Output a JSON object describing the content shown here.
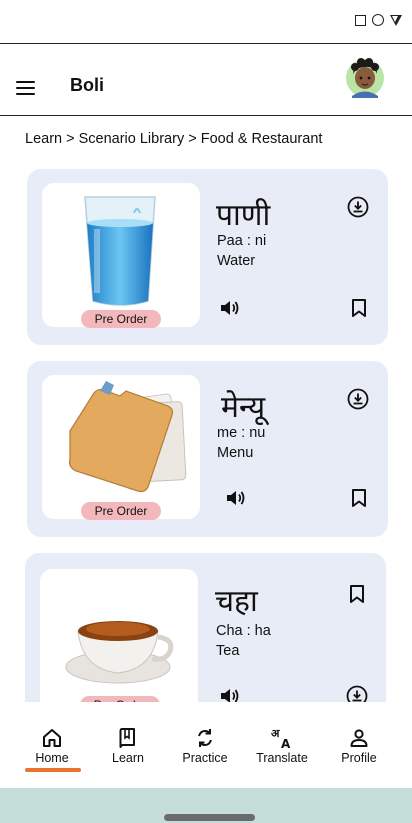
{
  "app": {
    "title": "Boli"
  },
  "breadcrumb": "Learn > Scenario Library > Food & Restaurant",
  "cards": [
    {
      "word": "पाणी",
      "pronunciation": "Paa : ni",
      "meaning": "Water",
      "badge": "Pre Order",
      "image": "water-glass"
    },
    {
      "word": "मेन्यू",
      "pronunciation": "me : nu",
      "meaning": "Menu",
      "badge": "Pre Order",
      "image": "menu-folder"
    },
    {
      "word": "चहा",
      "pronunciation": "Cha : ha",
      "meaning": "Tea",
      "badge": "Pre Order",
      "image": "tea-cup"
    }
  ],
  "nav": [
    {
      "label": "Home",
      "icon": "home-icon",
      "active": true
    },
    {
      "label": "Learn",
      "icon": "book-icon"
    },
    {
      "label": "Practice",
      "icon": "refresh-icon"
    },
    {
      "label": "Translate",
      "icon": "translate-icon"
    },
    {
      "label": "Profile",
      "icon": "person-icon"
    }
  ],
  "colors": {
    "card_bg": "#e8ecf7",
    "badge_bg": "#f2b8bc",
    "active_indicator": "#e8742e",
    "gesture_bar": "#c4ddd8"
  }
}
